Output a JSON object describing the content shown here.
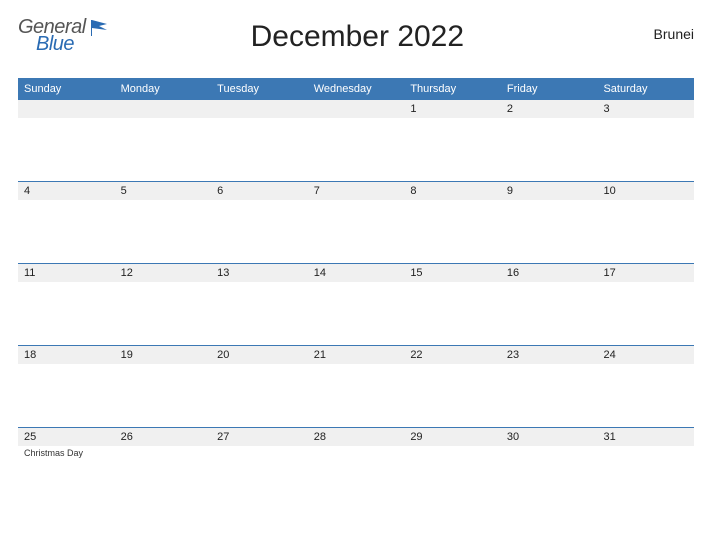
{
  "header": {
    "logo_general": "General",
    "logo_blue": "Blue",
    "title": "December 2022",
    "region": "Brunei"
  },
  "weekdays": [
    "Sunday",
    "Monday",
    "Tuesday",
    "Wednesday",
    "Thursday",
    "Friday",
    "Saturday"
  ],
  "weeks": [
    [
      {
        "day": "",
        "event": ""
      },
      {
        "day": "",
        "event": ""
      },
      {
        "day": "",
        "event": ""
      },
      {
        "day": "",
        "event": ""
      },
      {
        "day": "1",
        "event": ""
      },
      {
        "day": "2",
        "event": ""
      },
      {
        "day": "3",
        "event": ""
      }
    ],
    [
      {
        "day": "4",
        "event": ""
      },
      {
        "day": "5",
        "event": ""
      },
      {
        "day": "6",
        "event": ""
      },
      {
        "day": "7",
        "event": ""
      },
      {
        "day": "8",
        "event": ""
      },
      {
        "day": "9",
        "event": ""
      },
      {
        "day": "10",
        "event": ""
      }
    ],
    [
      {
        "day": "11",
        "event": ""
      },
      {
        "day": "12",
        "event": ""
      },
      {
        "day": "13",
        "event": ""
      },
      {
        "day": "14",
        "event": ""
      },
      {
        "day": "15",
        "event": ""
      },
      {
        "day": "16",
        "event": ""
      },
      {
        "day": "17",
        "event": ""
      }
    ],
    [
      {
        "day": "18",
        "event": ""
      },
      {
        "day": "19",
        "event": ""
      },
      {
        "day": "20",
        "event": ""
      },
      {
        "day": "21",
        "event": ""
      },
      {
        "day": "22",
        "event": ""
      },
      {
        "day": "23",
        "event": ""
      },
      {
        "day": "24",
        "event": ""
      }
    ],
    [
      {
        "day": "25",
        "event": "Christmas Day"
      },
      {
        "day": "26",
        "event": ""
      },
      {
        "day": "27",
        "event": ""
      },
      {
        "day": "28",
        "event": ""
      },
      {
        "day": "29",
        "event": ""
      },
      {
        "day": "30",
        "event": ""
      },
      {
        "day": "31",
        "event": ""
      }
    ]
  ]
}
